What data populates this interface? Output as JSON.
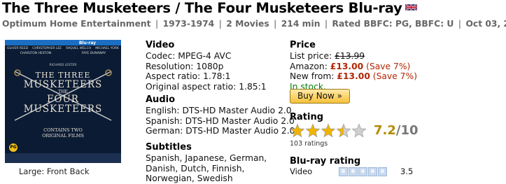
{
  "title": "The Three Musketeers / The Four Musketeers Blu-ray",
  "meta": {
    "studio": "Optimum Home Entertainment",
    "years": "1973-1974",
    "movies": "2 Movies",
    "runtime": "214 min",
    "rating": "Rated BBFC: PG, BBFC: U",
    "date": "Oct 03, 2011",
    "separator": "|"
  },
  "cover": {
    "band_label": "Blu-ray",
    "names": [
      "OLIVER REED",
      "CHRISTOPHER LEE",
      "RAQUEL WELCH",
      "MICHAEL YORK",
      "CHARLTON HESTON",
      "FAYE DUNAWAY"
    ],
    "director_line": "RICHARD LESTER",
    "title_line1": "THE THREE",
    "title_line2": "MUSKETEERS",
    "title_line3": "THE",
    "title_line4": "FOUR",
    "title_line5": "MUSKETEERS",
    "contains_line1": "CONTAINS TWO",
    "contains_line2": "ORIGINAL FILMS",
    "cert": "PG",
    "caption_large": "Large:",
    "caption_front": "Front",
    "caption_back": "Back"
  },
  "video": {
    "heading": "Video",
    "codec": "Codec: MPEG-4 AVC",
    "resolution": "Resolution: 1080p",
    "aspect": "Aspect ratio: 1.78:1",
    "original_aspect": "Original aspect ratio: 1.85:1"
  },
  "audio": {
    "heading": "Audio",
    "tracks": [
      "English: DTS-HD Master Audio 2.0",
      "Spanish: DTS-HD Master Audio 2.0",
      "German: DTS-HD Master Audio 2.0"
    ]
  },
  "subtitles": {
    "heading": "Subtitles",
    "text": "Spanish, Japanese, German, Danish, Dutch, Finnish, Norwegian, Swedish"
  },
  "price": {
    "heading": "Price",
    "list_label": "List price:",
    "list_value": "£13.99",
    "amazon_label": "Amazon:",
    "amazon_value": "£13.00",
    "amazon_save": "(Save 7%)",
    "new_label": "New from:",
    "new_value": "£13.00",
    "new_save": "(Save 7%)",
    "stock": "In stock.",
    "buy_label": "Buy Now »"
  },
  "rating": {
    "heading": "Rating",
    "value": "7.2",
    "max": "/10",
    "stars_filled": 3.5,
    "count": "103 ratings"
  },
  "bluray_rating": {
    "heading": "Blu-ray rating",
    "row_label": "Video",
    "row_value": "3.5"
  },
  "colors": {
    "price_red": "#b12704",
    "stock_green": "#0a7a0a",
    "star_gold": "#f0b400",
    "score_gold": "#b38b00"
  }
}
